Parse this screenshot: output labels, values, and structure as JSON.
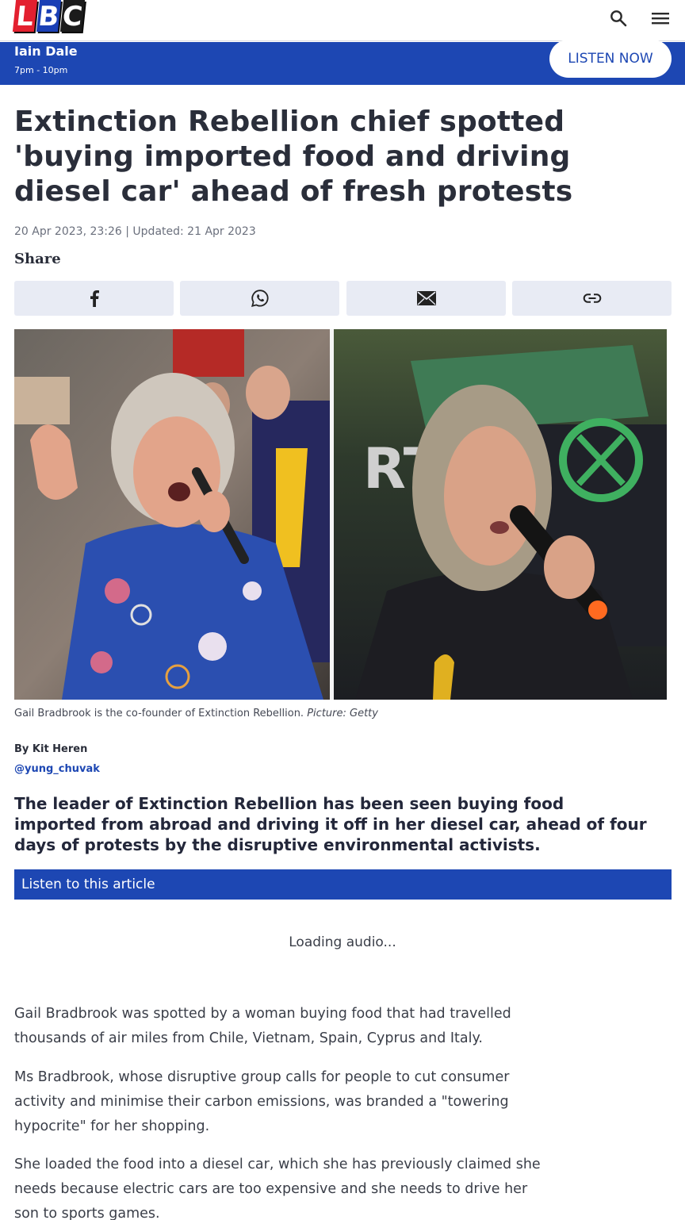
{
  "header": {
    "logo_letters": [
      "L",
      "B",
      "C"
    ],
    "logo_colors": [
      "#e3202f",
      "#1a3fb5",
      "#1b1b1b"
    ],
    "search_icon": "search-icon",
    "menu_icon": "hamburger-menu-icon"
  },
  "now_playing": {
    "show": "Iain Dale",
    "time": "7pm - 10pm",
    "listen_label": "LISTEN NOW",
    "bar_color": "#1d47b3"
  },
  "article": {
    "headline": "Extinction Rebellion chief spotted 'buying imported food and driving diesel car' ahead of fresh protests",
    "dateline": "20 Apr 2023, 23:26 | Updated: 21 Apr 2023",
    "share_label": "Share",
    "share_buttons": [
      "facebook-icon",
      "whatsapp-icon",
      "email-icon",
      "link-icon"
    ],
    "caption_text": "Gail Bradbrook is the co-founder of Extinction Rebellion.",
    "caption_credit": "Picture: Getty",
    "byline": "By Kit Heren",
    "handle": "@yung_chuvak",
    "standfirst": "The leader of Extinction Rebellion has been seen buying food imported from abroad and driving it off in her diesel car, ahead of four days of protests by the disruptive environmental activists.",
    "listen_label": "Listen to this article",
    "loading_text": "Loading audio...",
    "paragraphs": [
      "Gail Bradbrook was spotted by a woman buying food that had travelled thousands of air miles from Chile, Vietnam, Spain, Cyprus and Italy.",
      "Ms Bradbrook, whose disruptive group calls for people to cut consumer activity and minimise their carbon emissions, was branded a \"towering hypocrite\" for her shopping.",
      "She loaded the food into a diesel car, which she has previously claimed she needs because electric cars are too expensive and she needs to drive her son to sports games."
    ]
  }
}
